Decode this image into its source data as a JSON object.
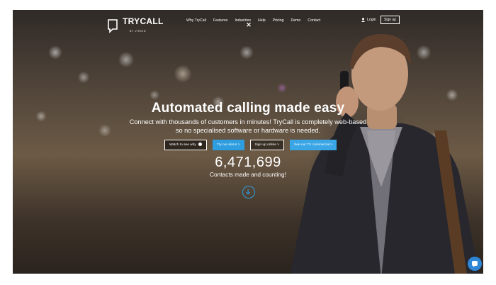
{
  "brand": {
    "name": "TRYCALL",
    "tagline": "BY VIRGIN"
  },
  "nav": {
    "items": [
      "Why TryCall",
      "Features",
      "Industries",
      "Help",
      "Pricing",
      "Demo",
      "Contact"
    ],
    "login_label": "Login",
    "signup_label": "Sign up"
  },
  "hero": {
    "headline": "Automated calling made easy",
    "subtext": "Connect with thousands of customers in minutes! TryCall is completely web-based so no specialised software or hardware is needed.",
    "buttons": {
      "watch": "Watch to see why",
      "demo": "Try our demo >",
      "signup": "Sign up online >",
      "tv": "See our TV commercial >"
    },
    "counter_value": "6,471,699",
    "counter_label": "Contacts made and counting!"
  },
  "colors": {
    "accent": "#2e9ee0",
    "chat": "#2e86d6"
  },
  "icons": [
    "logo-speech-icon",
    "close-icon",
    "user-icon",
    "play-icon",
    "arrow-down-icon",
    "chat-icon"
  ]
}
